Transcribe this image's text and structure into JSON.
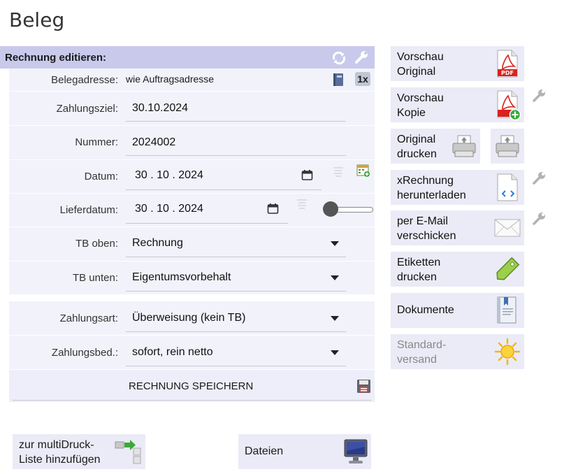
{
  "page": {
    "title": "Beleg"
  },
  "panel": {
    "header": "Rechnung editieren:",
    "fields": {
      "belegadresse": {
        "label": "Belegadresse:",
        "value": "wie Auftragsadresse"
      },
      "zahlungsziel": {
        "label": "Zahlungsziel:",
        "value": "30.10.2024"
      },
      "nummer": {
        "label": "Nummer:",
        "value": "2024002"
      },
      "datum": {
        "label": "Datum:",
        "value": "30 . 10 . 2024"
      },
      "lieferdatum": {
        "label": "Lieferdatum:",
        "value": "30 . 10 . 2024"
      },
      "tb_oben": {
        "label": "TB oben:",
        "value": "Rechnung"
      },
      "tb_unten": {
        "label": "TB unten:",
        "value": "Eigentumsvorbehalt"
      },
      "zahlungsart": {
        "label": "Zahlungsart:",
        "value": "Überweisung (kein TB)"
      },
      "zahlungsbed": {
        "label": "Zahlungsbed.:",
        "value": "sofort, rein netto"
      }
    },
    "copies_badge": "1x",
    "save_label": "RECHNUNG SPEICHERN"
  },
  "actions": {
    "vorschau_original": [
      "Vorschau",
      "Original"
    ],
    "vorschau_kopie": [
      "Vorschau",
      "Kopie"
    ],
    "original_drucken": [
      "Original",
      "drucken"
    ],
    "xrechnung": [
      "xRechnung",
      "herunterladen"
    ],
    "email": [
      "per E-Mail",
      "verschicken"
    ],
    "etiketten": [
      "Etiketten",
      "drucken"
    ],
    "dokumente": "Dokumente",
    "standardversand": [
      "Standard-",
      "versand"
    ],
    "pdf_text": "PDF"
  },
  "bottom": {
    "multidruck": [
      "zur multiDruck-",
      "Liste hinzufügen"
    ],
    "dateien": "Dateien"
  },
  "colors": {
    "header_bg": "#c9c9ec",
    "panel_bg": "#f2f2fb",
    "button_bg": "#ebebf7",
    "pdf_red": "#d9231f"
  }
}
